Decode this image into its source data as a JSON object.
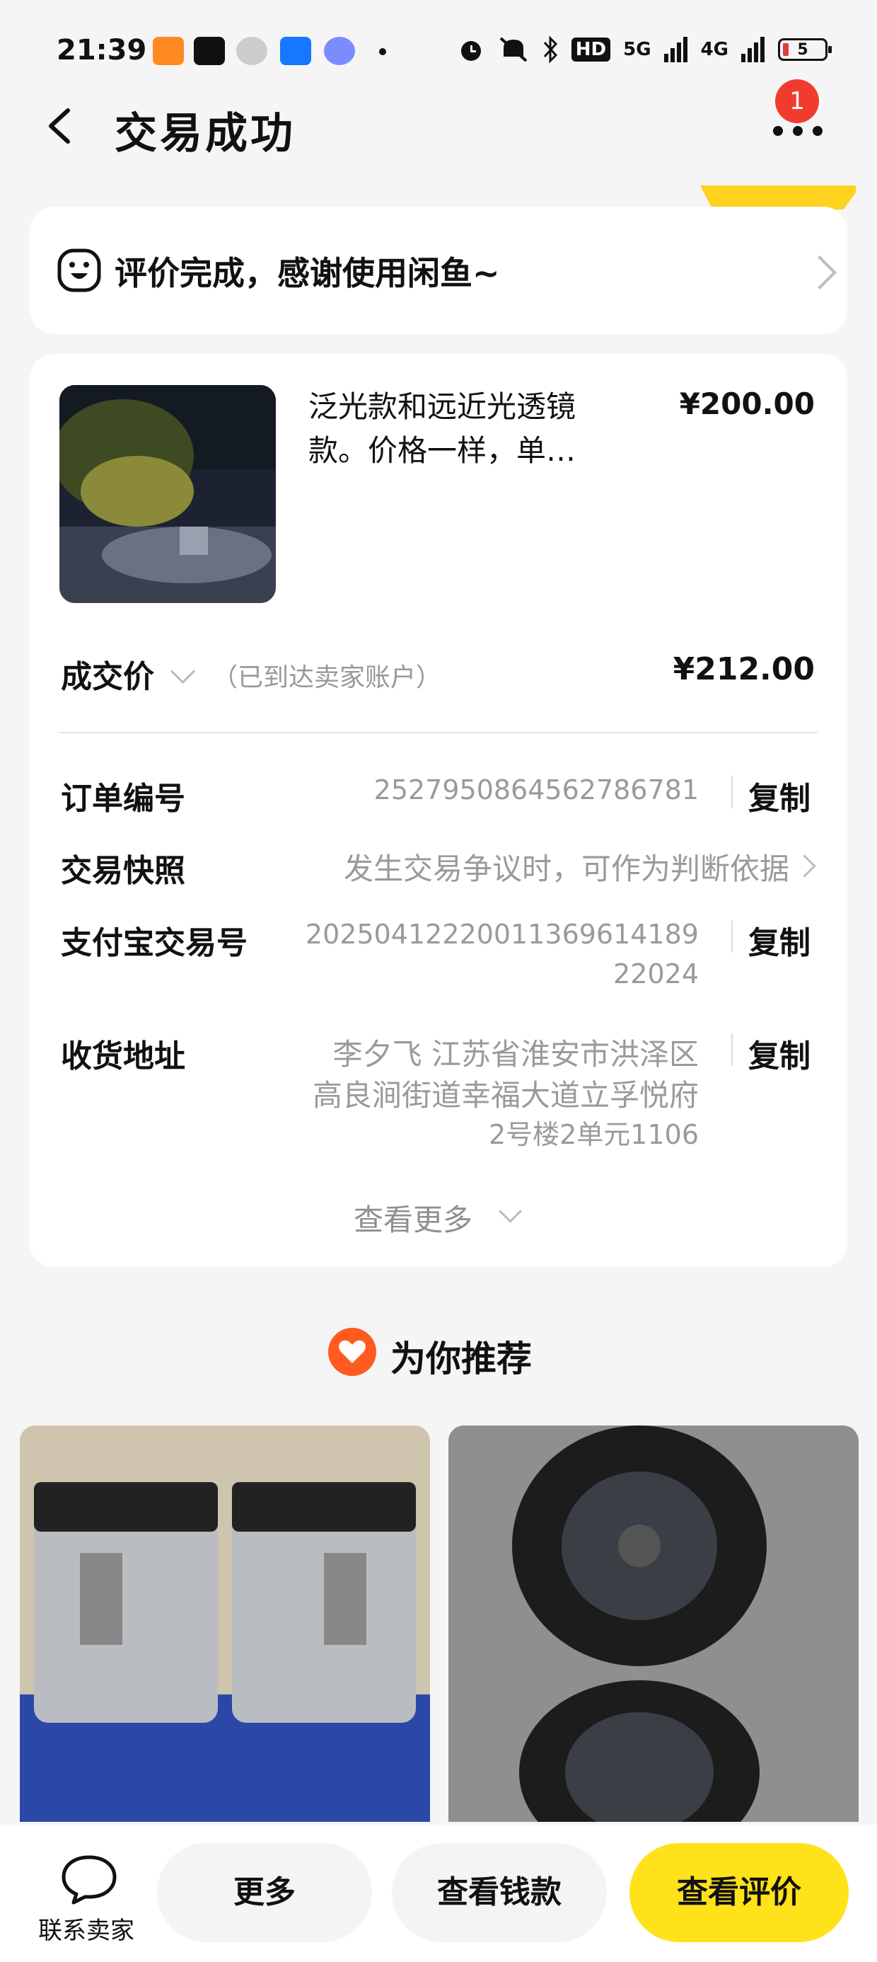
{
  "status_bar": {
    "time": "21:39",
    "network": "5G",
    "network2": "4G",
    "hd": "HD",
    "battery": "5"
  },
  "header": {
    "title": "交易成功",
    "badge_count": "1"
  },
  "review_banner": {
    "text": "评价完成，感谢使用闲鱼~"
  },
  "product": {
    "title": "泛光款和远近光透镜款。价格一样，单…",
    "price": "¥200.00"
  },
  "deal": {
    "label": "成交价",
    "note": "（已到达卖家账户）",
    "price": "¥212.00"
  },
  "details": {
    "order_no_label": "订单编号",
    "order_no": "2527950864562786781",
    "snapshot_label": "交易快照",
    "snapshot_value": "发生交易争议时，可作为判断依据",
    "alipay_label": "支付宝交易号",
    "alipay_line1": "2025041222001136961418​9",
    "alipay_line2": "22024",
    "address_label": "收货地址",
    "address_line1": "李夕飞 江苏省淮安市洪泽区",
    "address_line2": "高良涧街道幸福大道立孚悦府",
    "address_line3": "2号楼2单元1106",
    "copy_label": "复制",
    "see_more": "查看更多"
  },
  "recommend": {
    "title": "为你推荐"
  },
  "bottom_bar": {
    "contact_seller": "联系卖家",
    "more": "更多",
    "view_money": "查看钱款",
    "view_review": "查看评价"
  },
  "colors": {
    "accent_yellow": "#ffe21a",
    "badge_red": "#f23b2f",
    "heart_orange": "#ff5a1f"
  }
}
